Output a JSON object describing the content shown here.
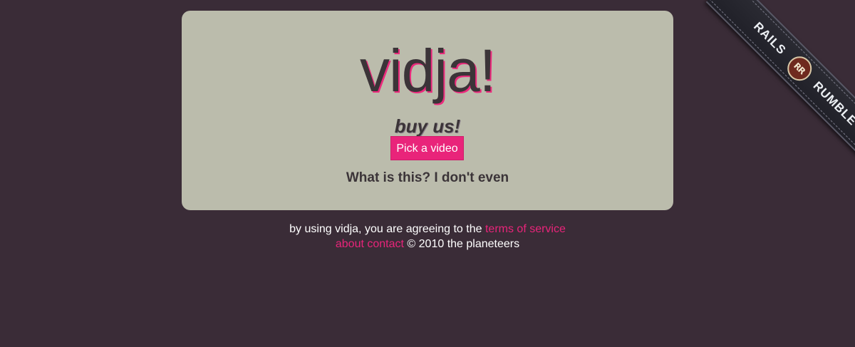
{
  "logo": {
    "text": "vidja!"
  },
  "tagline": "buy us!",
  "pick_button": "Pick a video",
  "whatis_text": "What is this? I don't even",
  "footer": {
    "line1_text": "by using vidja, you are agreeing to the",
    "tos_link": "terms of service",
    "about_link": "about",
    "contact_link": "contact",
    "copyright": "© 2010 the planeteers"
  },
  "ribbon": {
    "left_text": "RAILS",
    "emblem_text": "RR",
    "right_text": "RUMBLE"
  },
  "colors": {
    "background": "#3a2c37",
    "card": "#bbbcac",
    "accent": "#e9247a",
    "text_dark": "#3b3438"
  }
}
